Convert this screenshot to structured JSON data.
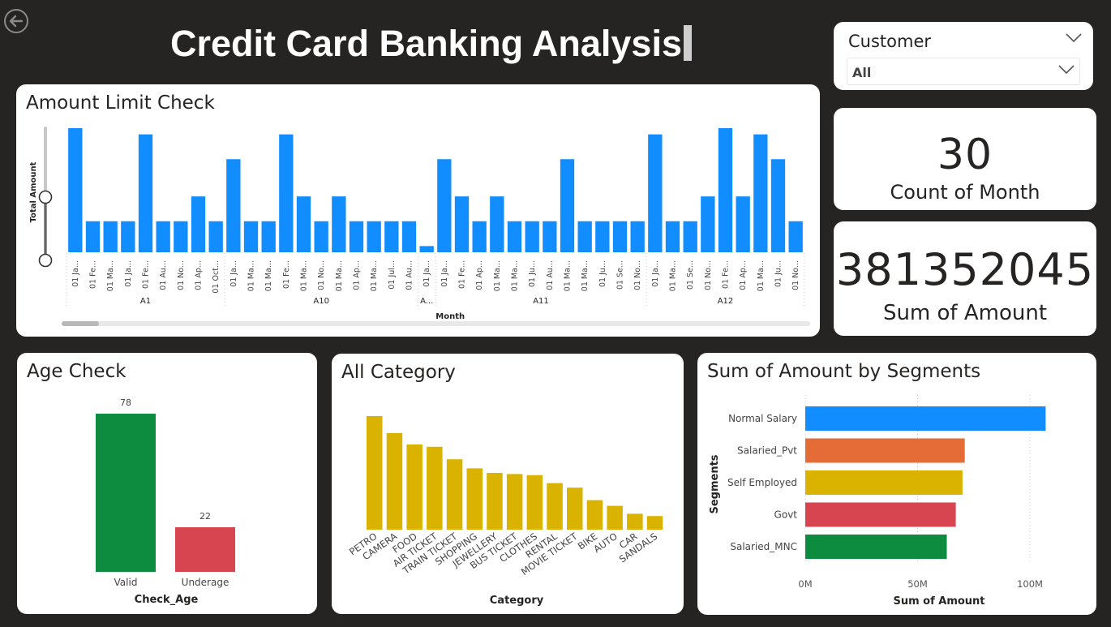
{
  "header": {
    "title": "Credit Card Banking Analysis"
  },
  "slicer": {
    "label": "Customer",
    "value": "All"
  },
  "kpis": [
    {
      "value": "30",
      "label": "Count of Month"
    },
    {
      "value": "381352045",
      "label": "Sum of Amount"
    }
  ],
  "colors": {
    "blue": "#118DFF",
    "gold": "#D9B300",
    "green": "#0D8B3E",
    "red": "#D64550",
    "orange": "#E66C37"
  },
  "chart_data": [
    {
      "id": "amount_limit",
      "type": "bar",
      "title": "Amount Limit Check",
      "xlabel": "Month",
      "ylabel": "Total Amount",
      "groups": [
        {
          "name": "A1",
          "count": 9
        },
        {
          "name": "A10",
          "count": 11
        },
        {
          "name": "A...",
          "count": 1
        },
        {
          "name": "A11",
          "count": 12
        },
        {
          "name": "A12",
          "count": 9
        }
      ],
      "categories": [
        "01 Ja...",
        "01 Fe...",
        "01 Ma...",
        "01 Ja...",
        "01 Fe...",
        "01 Au...",
        "01 No...",
        "01 Ap...",
        "01 Oct...",
        "01 Ja...",
        "01 Ma...",
        "01 Ma...",
        "01 Fe...",
        "01 Ma...",
        "01 No...",
        "01 Ma...",
        "01 Ap...",
        "01 Ma...",
        "01 Jul...",
        "01 Au...",
        "01 Ja...",
        "01 Ja...",
        "01 Fe...",
        "01 Ap...",
        "01 Ma...",
        "01 Ma...",
        "01 Ju...",
        "01 Au...",
        "01 Ma...",
        "01 Ma...",
        "01 Ju...",
        "01 Se...",
        "01 No...",
        "01 Ja...",
        "01 Ma...",
        "01 Se...",
        "01 No...",
        "01 Fe...",
        "01 Ap...",
        "01 Ma...",
        "01 Ju...",
        "01 No..."
      ],
      "values": [
        10,
        2.5,
        2.5,
        2.5,
        9.5,
        2.5,
        2.5,
        4.5,
        2.5,
        7.5,
        2.5,
        2.5,
        9.5,
        4.5,
        2.5,
        4.5,
        2.5,
        2.5,
        2.5,
        2.5,
        0.5,
        7.5,
        4.5,
        2.5,
        4.5,
        2.5,
        2.5,
        2.5,
        7.5,
        2.5,
        2.5,
        2.5,
        2.5,
        9.5,
        2.5,
        2.5,
        4.5,
        10,
        4.5,
        9.5,
        7.5,
        2.5
      ],
      "ylim": [
        0,
        10
      ]
    },
    {
      "id": "age_check",
      "type": "bar",
      "title": "Age Check",
      "xlabel": "Check_Age",
      "categories": [
        "Valid",
        "Underage"
      ],
      "values": [
        78,
        22
      ],
      "data_labels": [
        "78",
        "22"
      ]
    },
    {
      "id": "all_category",
      "type": "bar",
      "title": "All Category",
      "xlabel": "Category",
      "categories": [
        "PETRO",
        "CAMERA",
        "FOOD",
        "AIR TICKET",
        "TRAIN TICKET",
        "SHOPPING",
        "JEWELLERY",
        "BUS TICKET",
        "CLOTHES",
        "RENTAL",
        "MOVIE TICKET",
        "BIKE",
        "AUTO",
        "CAR",
        "SANDALS"
      ],
      "values": [
        100,
        85,
        75,
        73,
        62,
        54,
        50,
        49,
        48,
        41,
        37,
        26,
        21,
        14,
        12
      ],
      "ylim": [
        0,
        110
      ]
    },
    {
      "id": "segments",
      "type": "bar",
      "orientation": "horizontal",
      "title": "Sum of Amount by Segments",
      "xlabel": "Sum of Amount",
      "ylabel": "Segments",
      "categories": [
        "Normal Salary",
        "Salaried_Pvt",
        "Self Employed",
        "Govt",
        "Salaried_MNC"
      ],
      "values": [
        107,
        71,
        70,
        67,
        63
      ],
      "units": "M",
      "xticks": [
        "0M",
        "50M",
        "100M"
      ],
      "xlim": [
        0,
        100
      ]
    }
  ]
}
